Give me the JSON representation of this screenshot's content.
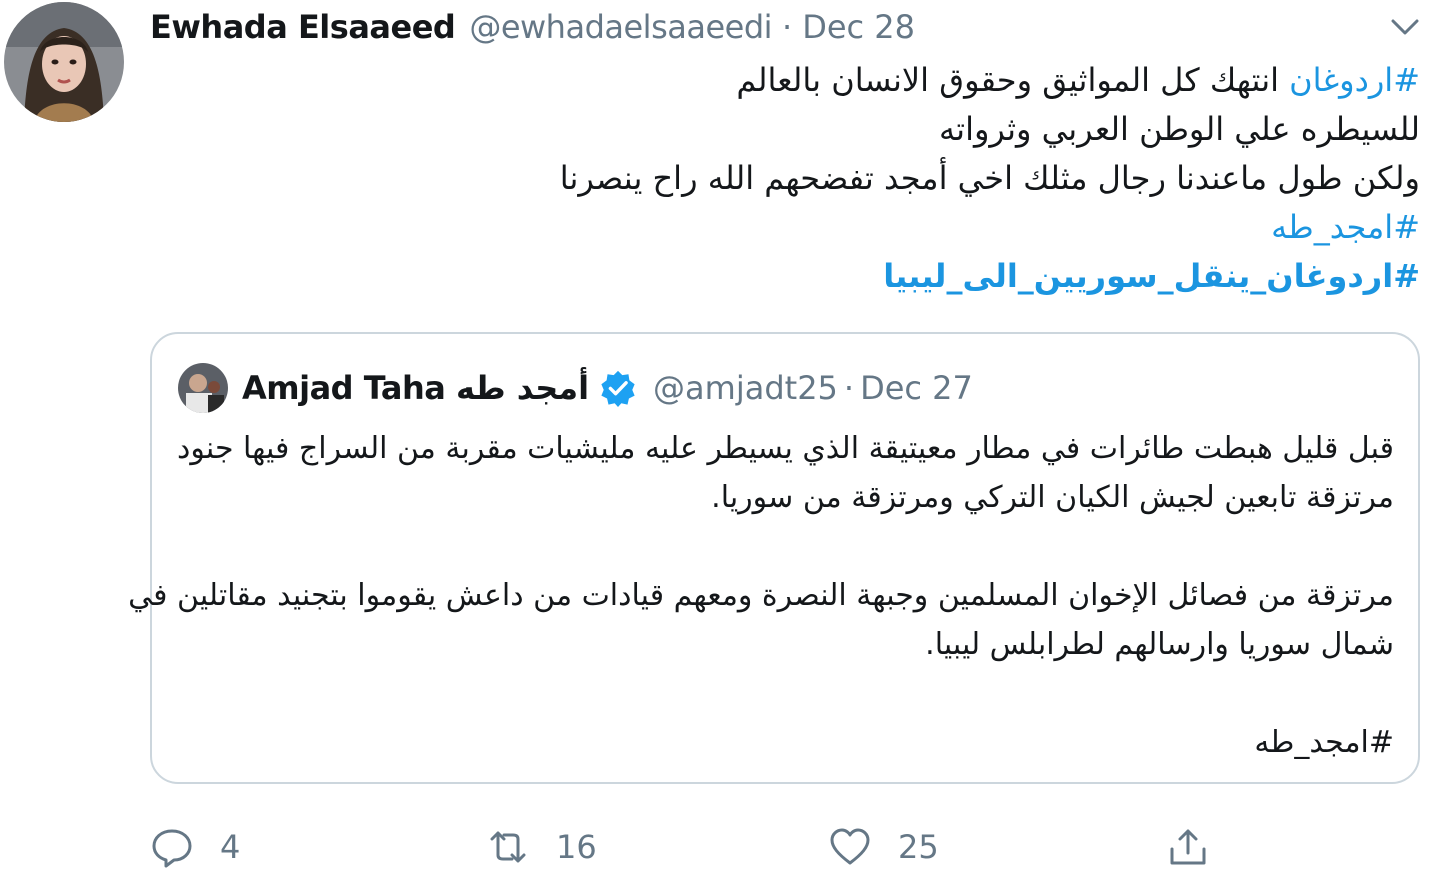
{
  "tweet": {
    "author_name": "Ewhada Elsaaeed",
    "author_handle": "@ewhadaelsaaeedi",
    "separator": "·",
    "date": "Dec 28",
    "lines": [
      {
        "hashtag": "#اردوغان",
        "text": " انتهك كل المواثيق وحقوق الانسان بالعالم"
      },
      {
        "text": "للسيطره علي الوطن العربي وثرواته"
      },
      {
        "text": "ولكن طول ماعندنا رجال مثلك اخي أمجد تفضحهم الله راح ينصرنا"
      }
    ],
    "hashtag_line_1": "#امجد_طه",
    "hashtag_line_2": "#اردوغان_ينقل_سوريين_الى_ليبيا"
  },
  "quoted": {
    "author_name": "Amjad Taha أمجد طه",
    "author_handle": "@amjadt25",
    "separator": "·",
    "date": "Dec 27",
    "para1_line1": "قبل قليل هبطت طائرات في مطار معيتيقة الذي يسيطر عليه مليشيات مقربة من السراج فيها جنود",
    "para1_line2": "مرتزقة تابعين لجيش الكيان التركي ومرتزقة من سوريا.",
    "para2_line1": "مرتزقة من فصائل الإخوان المسلمين وجبهة النصرة ومعهم قيادات من داعش يقوموا بتجنيد مقاتلين في",
    "para2_line2": "شمال سوريا وارسالهم لطرابلس ليبيا.",
    "hashtag": "#امجد_طه"
  },
  "actions": {
    "reply_count": "4",
    "retweet_count": "16",
    "like_count": "25"
  },
  "icons": {
    "reply": "reply-icon",
    "retweet": "retweet-icon",
    "like": "heart-icon",
    "share": "share-icon",
    "caret": "chevron-down-icon",
    "verified": "verified-badge-icon"
  },
  "colors": {
    "link": "#1b95e0",
    "muted": "#657786",
    "border": "#ccd6dd",
    "verified": "#1da1f2"
  }
}
